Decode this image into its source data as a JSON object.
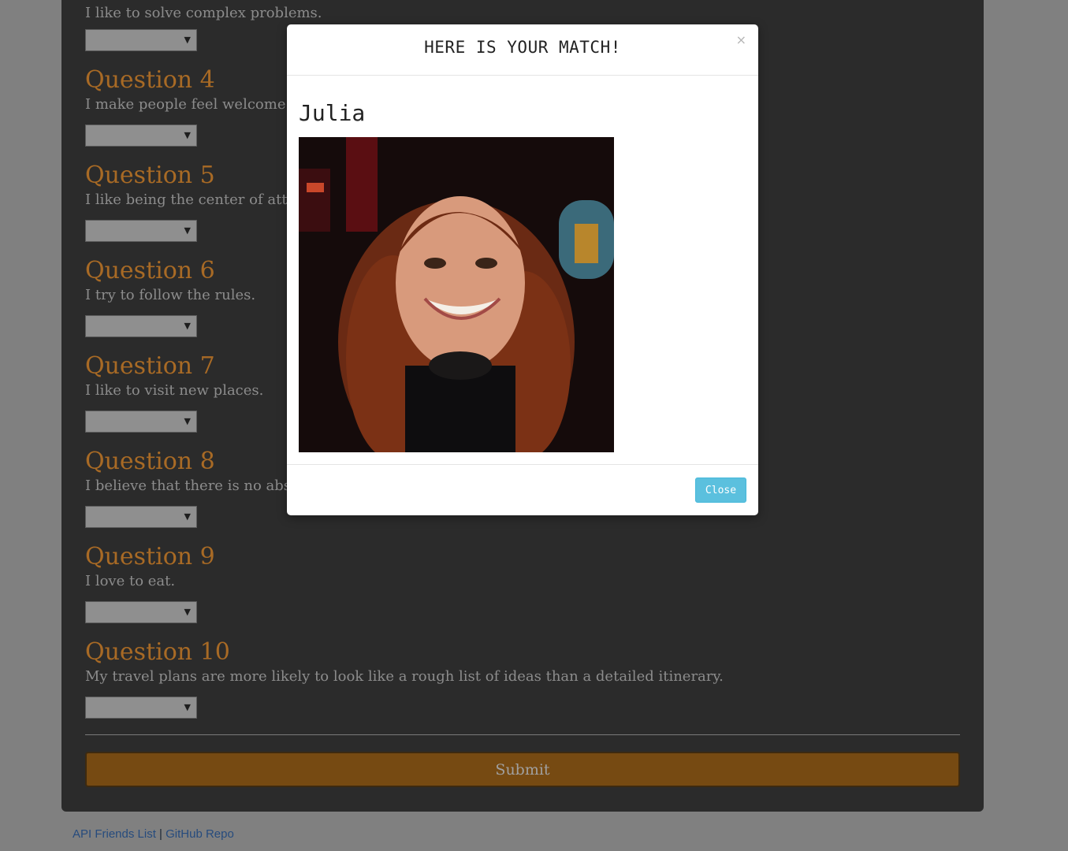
{
  "survey": {
    "partial_question_text": "I like to solve complex problems.",
    "questions": [
      {
        "title": "Question 4",
        "text": "I make people feel welcome."
      },
      {
        "title": "Question 5",
        "text": "I like being the center of atte"
      },
      {
        "title": "Question 6",
        "text": "I try to follow the rules."
      },
      {
        "title": "Question 7",
        "text": "I like to visit new places."
      },
      {
        "title": "Question 8",
        "text": "I believe that there is no abs"
      },
      {
        "title": "Question 9",
        "text": "I love to eat."
      },
      {
        "title": "Question 10",
        "text": "My travel plans are more likely to look like a rough list of ideas than a detailed itinerary."
      }
    ],
    "select_arrow": "▼",
    "submit_label": "Submit"
  },
  "footer": {
    "link_api": "API Friends List",
    "separator": "|",
    "link_github": "GitHub Repo"
  },
  "modal": {
    "title": "HERE IS YOUR MATCH!",
    "close_x": "×",
    "match_name": "Julia",
    "photo_alt": "photo",
    "close_label": "Close"
  },
  "colors": {
    "accent": "#a86a25",
    "submit_bg": "#764a12",
    "close_btn": "#5bc0de"
  }
}
